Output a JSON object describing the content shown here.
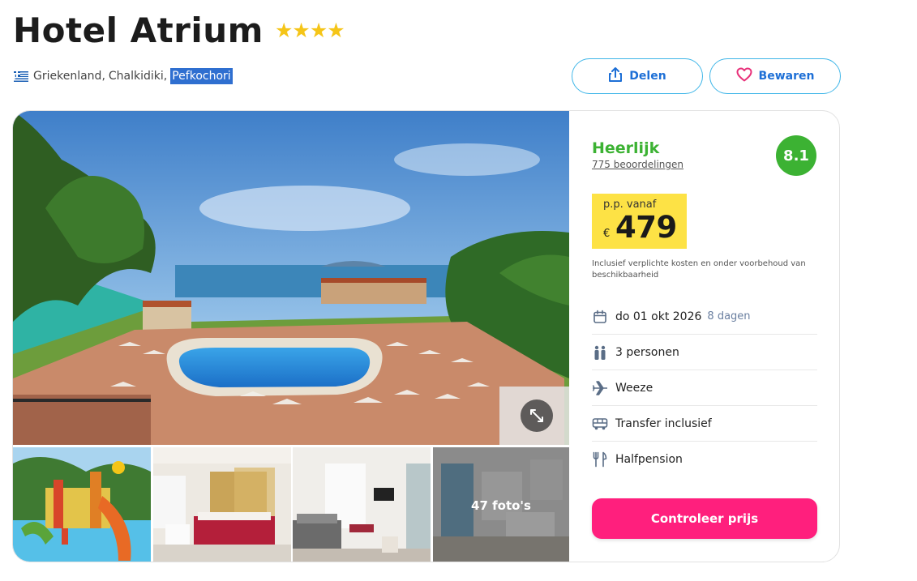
{
  "hotel": {
    "name": "Hotel Atrium",
    "stars_text": "★★★★",
    "star_count": 4
  },
  "location": {
    "flag_icon": "greece-flag-icon",
    "country": "Griekenland",
    "region": "Chalkidiki",
    "town": "Pefkochori"
  },
  "actions": {
    "share_label": "Delen",
    "save_label": "Bewaren"
  },
  "gallery": {
    "more_photos_label": "47 foto's"
  },
  "review": {
    "rating_word": "Heerlijk",
    "reviews_text": "775 beoordelingen",
    "score": "8.1"
  },
  "price": {
    "label": "p.p. vanaf",
    "currency": "€",
    "amount": "479",
    "disclaimer": "Inclusief verplichte kosten en onder voorbehoud van beschikbaarheid"
  },
  "details": [
    {
      "icon": "calendar-icon",
      "text": "do 01 okt 2026",
      "sub": "8 dagen"
    },
    {
      "icon": "persons-icon",
      "text": "3 personen"
    },
    {
      "icon": "plane-icon",
      "text": "Weeze"
    },
    {
      "icon": "bus-icon",
      "text": "Transfer inclusief"
    },
    {
      "icon": "cutlery-icon",
      "text": "Halfpension"
    }
  ],
  "cta": {
    "label": "Controleer prijs"
  },
  "colors": {
    "accent_blue": "#1d6fd6",
    "outline_blue": "#3fb6e8",
    "rating_green": "#3cb233",
    "price_yellow": "#fde245",
    "cta_pink": "#ff1f7d",
    "star_yellow": "#f5c518",
    "heart_pink": "#e8317a"
  }
}
